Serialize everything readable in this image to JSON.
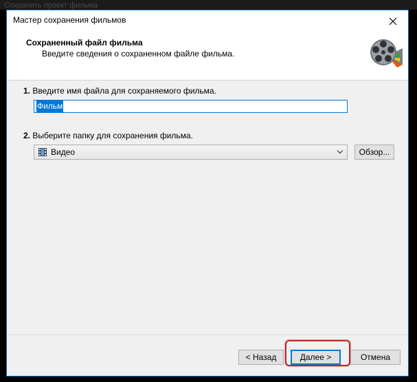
{
  "background": {
    "ghost_text": "Сохранить проект фильма"
  },
  "window": {
    "title": "Мастер сохранения фильмов",
    "close_icon": "close-icon"
  },
  "header": {
    "title": "Сохраненный файл фильма",
    "subtitle": "Введите сведения о сохраненном файле фильма.",
    "logo_icon": "film-reel-icon"
  },
  "step1": {
    "number": "1.",
    "label": "Введите имя файла для сохраняемого фильма.",
    "value": "Фильм"
  },
  "step2": {
    "number": "2.",
    "label": "Выберите папку для сохранения фильма.",
    "folder": "Видео",
    "folder_icon": "video-folder-icon",
    "browse_label": "Обзор..."
  },
  "footer": {
    "back_label": "< Назад",
    "next_label": "Далее >",
    "cancel_label": "Отмена"
  },
  "colors": {
    "accent": "#0078d7",
    "highlight": "#c1282e"
  }
}
